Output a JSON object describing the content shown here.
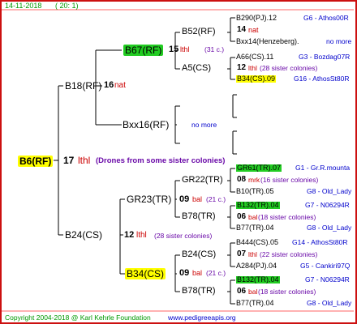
{
  "header": {
    "date": "14-11-2018",
    "ids": "( 20: 1)"
  },
  "footer": {
    "copyright": "Copyright 2004-2018 @ Karl Kehrle Foundation",
    "website": "www.pedigreeapis.org"
  },
  "root": {
    "id": "B6(RF)",
    "num": "17",
    "mark": "lthl",
    "note": "(Drones from some sister colonies)"
  },
  "gen1": {
    "top": {
      "id": "B18(RF)",
      "num": "16",
      "mark": "nat"
    },
    "bottom": {
      "id": "B24(CS)",
      "num": "12",
      "mark": "lthl",
      "note": "(28 sister colonies)"
    }
  },
  "gen2": {
    "a": {
      "id": "B67(RF)",
      "num": "15",
      "mark": "lthl",
      "note": "(31 c.)"
    },
    "b": {
      "id": "Bxx16(RF)",
      "note": "no more"
    },
    "c": {
      "id": "GR23(TR)",
      "num": "09",
      "mark": "bal",
      "note": "(21 c.)"
    },
    "d": {
      "id": "B34(CS)",
      "num": "09",
      "mark": "bal",
      "note": "(21 c.)"
    }
  },
  "gen3": {
    "a1": {
      "id": "B52(RF)",
      "num": "14",
      "mark": "nat"
    },
    "a2": {
      "id": "A5(CS)",
      "num": "12",
      "mark": "lthl",
      "note": "(28 sister colonies)"
    },
    "c1": {
      "id": "GR22(TR)",
      "num": "08",
      "mark": "mrk",
      "note": "(16 sister colonies)"
    },
    "c2": {
      "id": "B78(TR)",
      "num": "06",
      "mark": "bal",
      "note": "(18 sister colonies)"
    },
    "d1": {
      "id": "B24(CS)",
      "num": "07",
      "mark": "lthl",
      "note": "(22 sister colonies)"
    },
    "d2": {
      "id": "B78(TR)",
      "num": "06",
      "mark": "bal",
      "note": "(18 sister colonies)"
    }
  },
  "gen4": [
    {
      "id": "B290(PJ).12",
      "right": "G6 - Athos00R"
    },
    {
      "id": "Bxx14(Henzeberg).",
      "right": "no more"
    },
    {
      "id": "A66(CS).11",
      "right": "G3 - Bozdag07R"
    },
    {
      "id": "B34(CS).09",
      "right": "G16 - AthosSt80R"
    },
    {
      "id": "GR61(TR).07",
      "right": "G1 - Gr.R.mounta"
    },
    {
      "id": "B10(TR).05",
      "right": "G8 - Old_Lady"
    },
    {
      "id": "B132(TR).04",
      "right": "G7 - N06294R"
    },
    {
      "id": "B77(TR).04",
      "right": "G8 - Old_Lady"
    },
    {
      "id": "B444(CS).05",
      "right": "G14 - AthosSt80R"
    },
    {
      "id": "A284(PJ).04",
      "right": "G5 - Cankiri97Q"
    },
    {
      "id": "B132(TR).04",
      "right": "G7 - N06294R"
    },
    {
      "id": "B77(TR).04",
      "right": "G8 - Old_Lady"
    }
  ],
  "colors": {
    "yellow": "#ffff00",
    "green": "#22cc22",
    "frame": "#cc1010",
    "link": "#0000cc"
  }
}
